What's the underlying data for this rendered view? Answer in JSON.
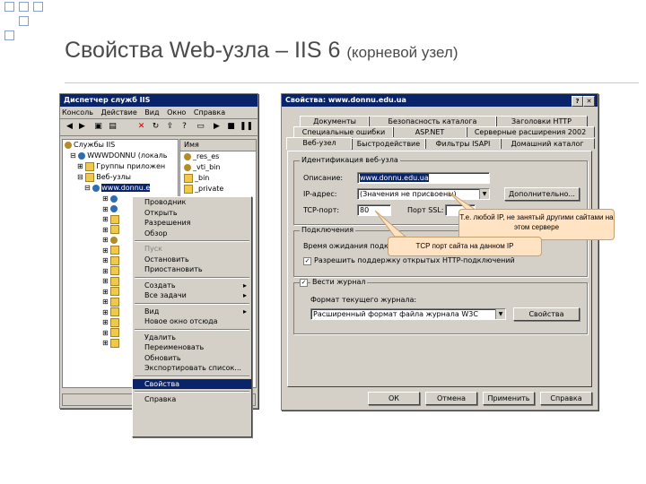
{
  "slide": {
    "title": "Свойства Web-узла – IIS 6",
    "subtitle": "(корневой узел)"
  },
  "iis_manager": {
    "title": "Диспетчер служб IIS",
    "menu": [
      "Консоль",
      "Действие",
      "Вид",
      "Окно",
      "Справка"
    ],
    "tree": [
      "Службы IIS",
      "WWWDONNU (локаль",
      "Группы приложен",
      "Веб-узлы",
      "www.donnu.e"
    ],
    "right_header": "Имя",
    "right_items": [
      "_res_es",
      "_vti_bin",
      "_bin",
      "_private"
    ]
  },
  "context_menu": {
    "items": [
      {
        "label": "Проводник",
        "disabled": false
      },
      {
        "label": "Открыть",
        "disabled": false
      },
      {
        "label": "Разрешения",
        "disabled": false
      },
      {
        "label": "Обзор",
        "disabled": false
      },
      {
        "sep": true
      },
      {
        "label": "Пуск",
        "disabled": true
      },
      {
        "label": "Остановить",
        "disabled": false
      },
      {
        "label": "Приостановить",
        "disabled": false
      },
      {
        "sep": true
      },
      {
        "label": "Создать",
        "submenu": true
      },
      {
        "label": "Все задачи",
        "submenu": true
      },
      {
        "sep": true
      },
      {
        "label": "Вид",
        "submenu": true
      },
      {
        "label": "Новое окно отсюда",
        "disabled": false
      },
      {
        "sep": true
      },
      {
        "label": "Удалить",
        "disabled": false
      },
      {
        "label": "Переименовать",
        "disabled": false
      },
      {
        "label": "Обновить",
        "disabled": false
      },
      {
        "label": "Экспортировать список...",
        "disabled": false
      },
      {
        "sep": true
      },
      {
        "label": "Свойства",
        "selected": true
      },
      {
        "sep": true
      },
      {
        "label": "Справка",
        "disabled": false
      }
    ]
  },
  "properties": {
    "title": "Свойства: www.donnu.edu.ua",
    "tabs_row1": [
      "Документы",
      "Безопасность каталога",
      "Заголовки HTTP"
    ],
    "tabs_row2": [
      "Специальные ошибки",
      "ASP.NET",
      "Серверные расширения 2002"
    ],
    "tabs_row3": [
      "Веб-узел",
      "Быстродействие",
      "Фильтры ISAPI",
      "Домашний каталог"
    ],
    "group_ident": "Идентификация веб-узла",
    "label_desc": "Описание:",
    "value_desc": "www.donnu.edu.ua",
    "label_ip": "IP-адрес:",
    "value_ip": "(Значения не присвоены)",
    "btn_advanced": "Дополнительно...",
    "label_tcp": "TCP-порт:",
    "value_tcp": "80",
    "label_ssl": "Порт SSL:",
    "group_conn": "Подключения",
    "label_timeout": "Время ожидания подключения",
    "chk_keepalive": "Разрешить поддержку открытых HTTP-подключений",
    "chk_log": "Вести журнал",
    "label_logformat": "Формат текущего журнала:",
    "value_logformat": "Расширенный формат файла журнала W3C",
    "btn_props": "Свойства",
    "btn_ok": "ОК",
    "btn_cancel": "Отмена",
    "btn_apply": "Применить",
    "btn_help": "Справка"
  },
  "callouts": {
    "ip_note": "Т.е. любой IP, не занятый другими сайтами на этом сервере",
    "tcp_note": "TCP порт сайта на данном IP"
  },
  "colors": {
    "title_bar": "#0a246a",
    "callout_fill": "#ffe3c2",
    "bullet_border": "#8a9fc4"
  }
}
